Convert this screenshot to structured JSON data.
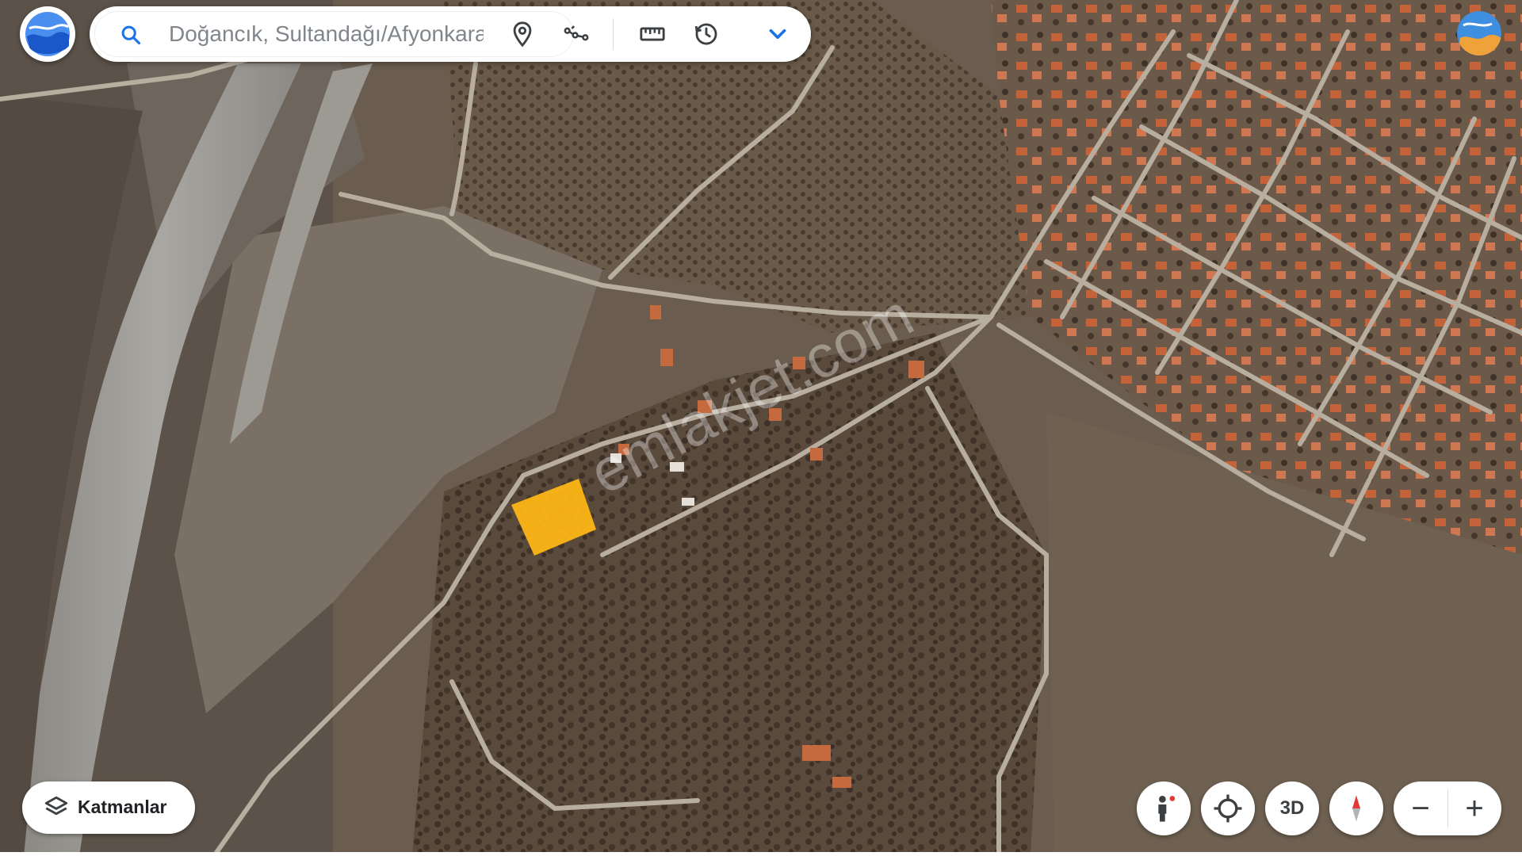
{
  "search": {
    "value": "Doğancık, Sultandağı/Afyonkarahisar"
  },
  "toolbar": {
    "location_icon": "location-pin-icon",
    "route_icon": "route-icon",
    "measure_icon": "ruler-icon",
    "history_icon": "history-icon",
    "expand_icon": "chevron-down-icon"
  },
  "watermark": "emlakjet.com",
  "layers": {
    "label": "Katmanlar",
    "icon": "layers-icon"
  },
  "controls": {
    "street_view_icon": "pegman-icon",
    "my_location_icon": "locate-icon",
    "three_d_label": "3D",
    "compass_icon": "compass-icon",
    "zoom_out_label": "−",
    "zoom_in_label": "+"
  },
  "colors": {
    "parcel": "#fdb515",
    "accent": "#1a73e8",
    "compass_red": "#e53935"
  }
}
